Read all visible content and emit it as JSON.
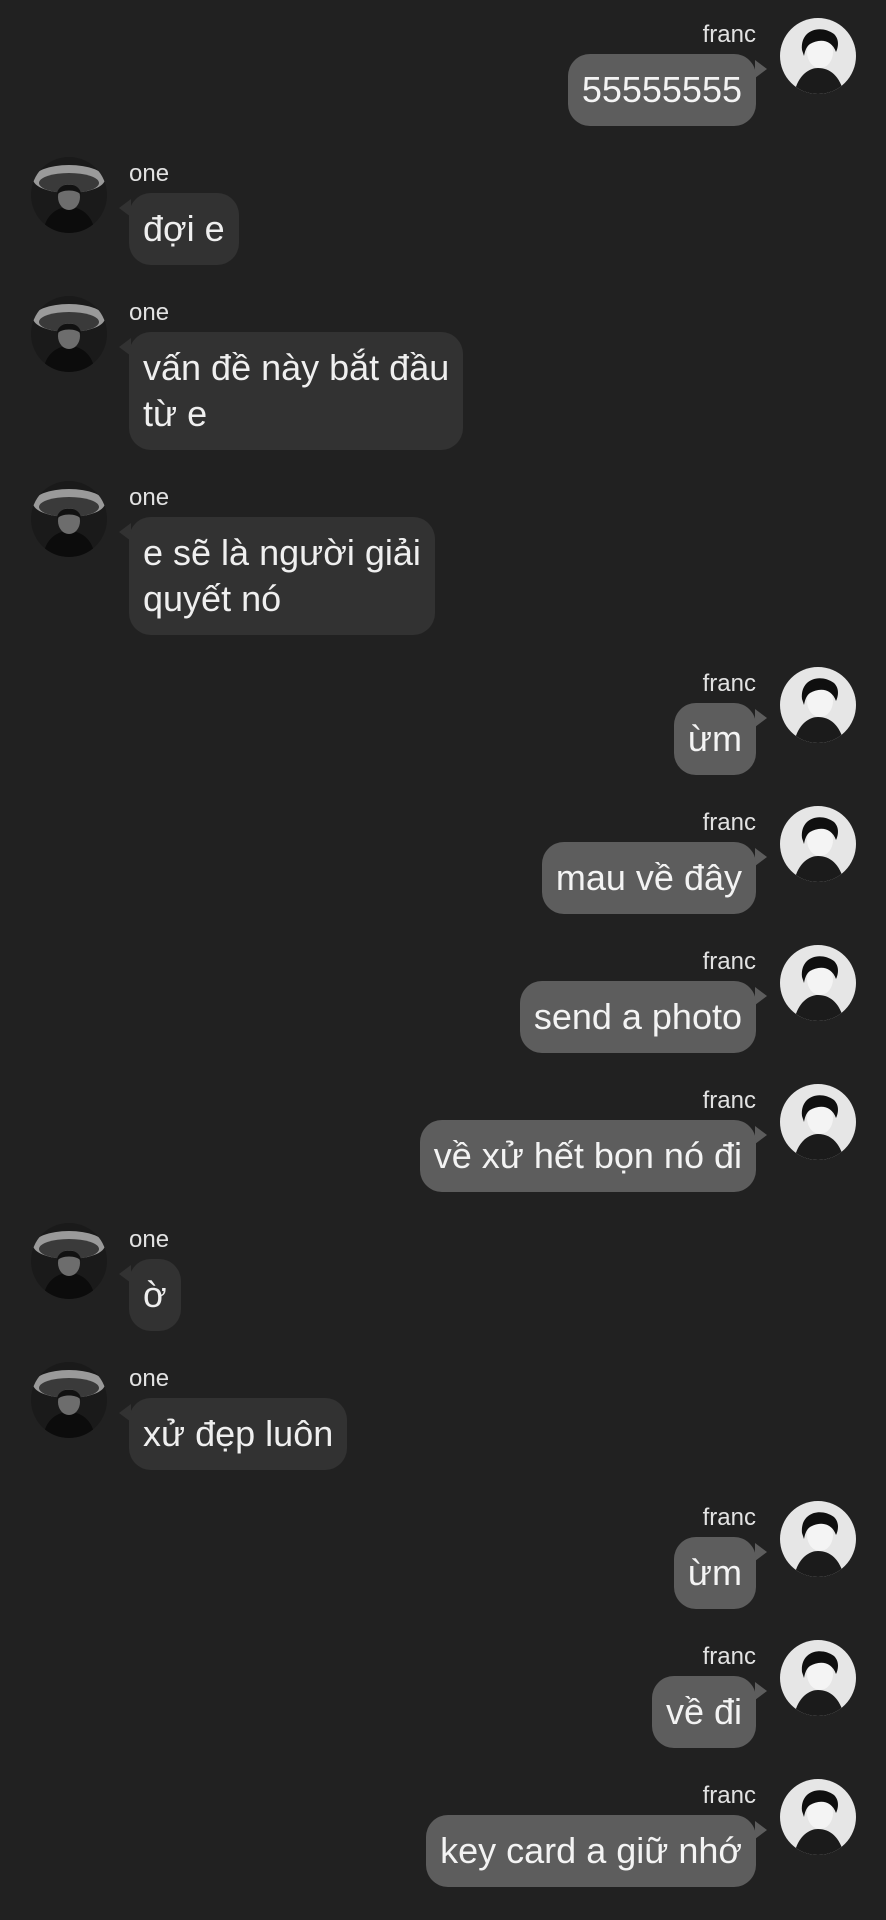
{
  "chat": {
    "messages": [
      {
        "side": "out",
        "sender": "franc",
        "text": "55555555"
      },
      {
        "side": "in",
        "sender": "one",
        "text": "đợi e"
      },
      {
        "side": "in",
        "sender": "one",
        "text": "vấn đề này bắt đầu\ntừ e"
      },
      {
        "side": "in",
        "sender": "one",
        "text": "e sẽ là người giải\nquyết nó"
      },
      {
        "side": "out",
        "sender": "franc",
        "text": "ừm"
      },
      {
        "side": "out",
        "sender": "franc",
        "text": "mau về đây"
      },
      {
        "side": "out",
        "sender": "franc",
        "text": "send a photo"
      },
      {
        "side": "out",
        "sender": "franc",
        "text": "về xử hết bọn nó đi"
      },
      {
        "side": "in",
        "sender": "one",
        "text": "ờ"
      },
      {
        "side": "in",
        "sender": "one",
        "text": "xử đẹp luôn"
      },
      {
        "side": "out",
        "sender": "franc",
        "text": "ừm"
      },
      {
        "side": "out",
        "sender": "franc",
        "text": "về đi"
      },
      {
        "side": "out",
        "sender": "franc",
        "text": "key card a giữ nhớ"
      }
    ]
  },
  "colors": {
    "background": "#212121",
    "incoming_bubble": "#323232",
    "outgoing_bubble": "#5d5d5d",
    "text": "#efefef"
  }
}
